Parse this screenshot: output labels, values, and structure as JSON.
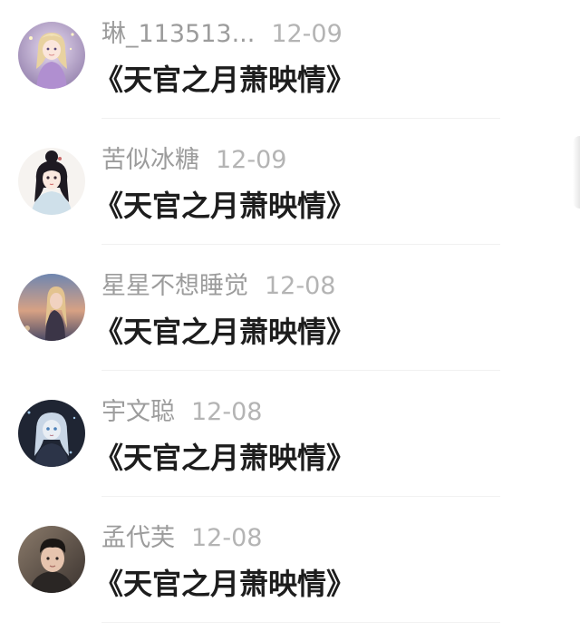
{
  "comments": [
    {
      "username": "琳_113513...",
      "date": "12-09",
      "text": "《天官之月萧映情》",
      "avatar_icon": "girl-purple-dress-avatar-icon"
    },
    {
      "username": "苦似冰糖",
      "date": "12-09",
      "text": "《天官之月萧映情》",
      "avatar_icon": "anime-girl-hair-bun-avatar-icon"
    },
    {
      "username": "星星不想睡觉",
      "date": "12-08",
      "text": "《天官之月萧映情》",
      "avatar_icon": "sunset-girl-avatar-icon"
    },
    {
      "username": "宇文聪",
      "date": "12-08",
      "text": "《天官之月萧映情》",
      "avatar_icon": "dark-anime-girl-avatar-icon"
    },
    {
      "username": "孟代芙",
      "date": "12-08",
      "text": "《天官之月萧映情》",
      "avatar_icon": "young-man-photo-avatar-icon"
    }
  ],
  "colors": {
    "username": "#9c9c9c",
    "date": "#b4b4b4",
    "comment_text": "#1d1d1d",
    "divider": "#f1f1f1"
  }
}
